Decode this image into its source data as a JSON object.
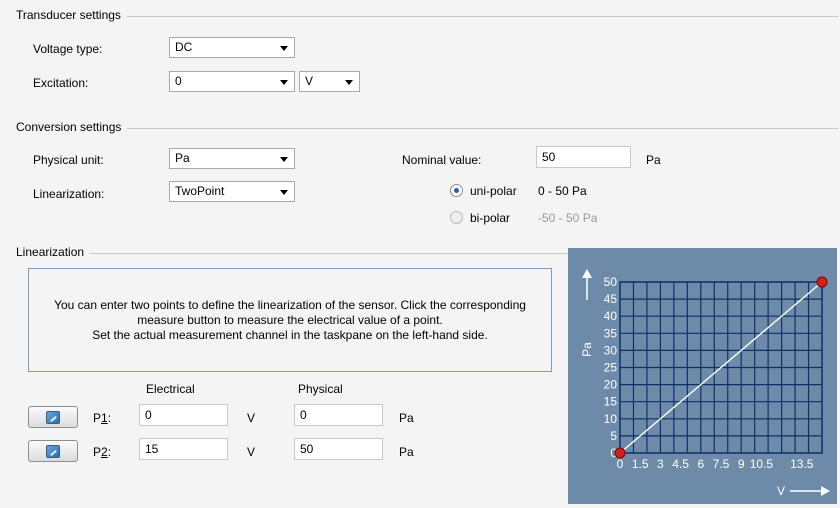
{
  "transducer": {
    "title": "Transducer settings",
    "voltage_type_label": "Voltage type:",
    "voltage_type_value": "DC",
    "excitation_label": "Excitation:",
    "excitation_value": "0",
    "excitation_unit": "V"
  },
  "conversion": {
    "title": "Conversion settings",
    "physical_unit_label": "Physical unit:",
    "physical_unit_value": "Pa",
    "linearization_label": "Linearization:",
    "linearization_value": "TwoPoint",
    "nominal_value_label": "Nominal value:",
    "nominal_value": "50",
    "nominal_unit": "Pa",
    "unipolar_label": "uni-polar",
    "unipolar_range": "0 - 50 Pa",
    "unipolar_selected": true,
    "bipolar_label": "bi-polar",
    "bipolar_range": "-50 - 50 Pa"
  },
  "linearization": {
    "title": "Linearization",
    "info_line1": "You can enter two points to define the linearization of the sensor. Click the corresponding",
    "info_line2": "measure button to measure the electrical value of a point.",
    "info_line3": "Set the actual measurement channel in the taskpane on the left-hand side.",
    "electrical_header": "Electrical",
    "physical_header": "Physical",
    "points": [
      {
        "label_prefix": "P",
        "label_num": "1",
        "label_suffix": ":",
        "electrical": "0",
        "electrical_unit": "V",
        "physical": "0",
        "physical_unit": "Pa"
      },
      {
        "label_prefix": "P",
        "label_num": "2",
        "label_suffix": ":",
        "electrical": "15",
        "electrical_unit": "V",
        "physical": "50",
        "physical_unit": "Pa"
      }
    ]
  },
  "chart_data": {
    "type": "line",
    "x": [
      0,
      15
    ],
    "y": [
      0,
      50
    ],
    "xlabel": "V",
    "ylabel": "Pa",
    "x_ticks": [
      "0",
      "1.5",
      "3",
      "4.5",
      "6",
      "7.5",
      "9",
      "10.5",
      "13.5"
    ],
    "x_tick_values": [
      0,
      1.5,
      3,
      4.5,
      6,
      7.5,
      9,
      10.5,
      13.5
    ],
    "y_ticks": [
      "0",
      "5",
      "10",
      "15",
      "20",
      "25",
      "30",
      "35",
      "40",
      "45",
      "50"
    ],
    "y_tick_values": [
      0,
      5,
      10,
      15,
      20,
      25,
      30,
      35,
      40,
      45,
      50
    ],
    "xlim": [
      0,
      15
    ],
    "ylim": [
      0,
      50
    ],
    "grid": true,
    "colors": {
      "background": "#6d8ba8",
      "grid": "#0e2f6b",
      "line": "#ffffff",
      "point": "#d42020",
      "text": "#ffffff"
    }
  }
}
